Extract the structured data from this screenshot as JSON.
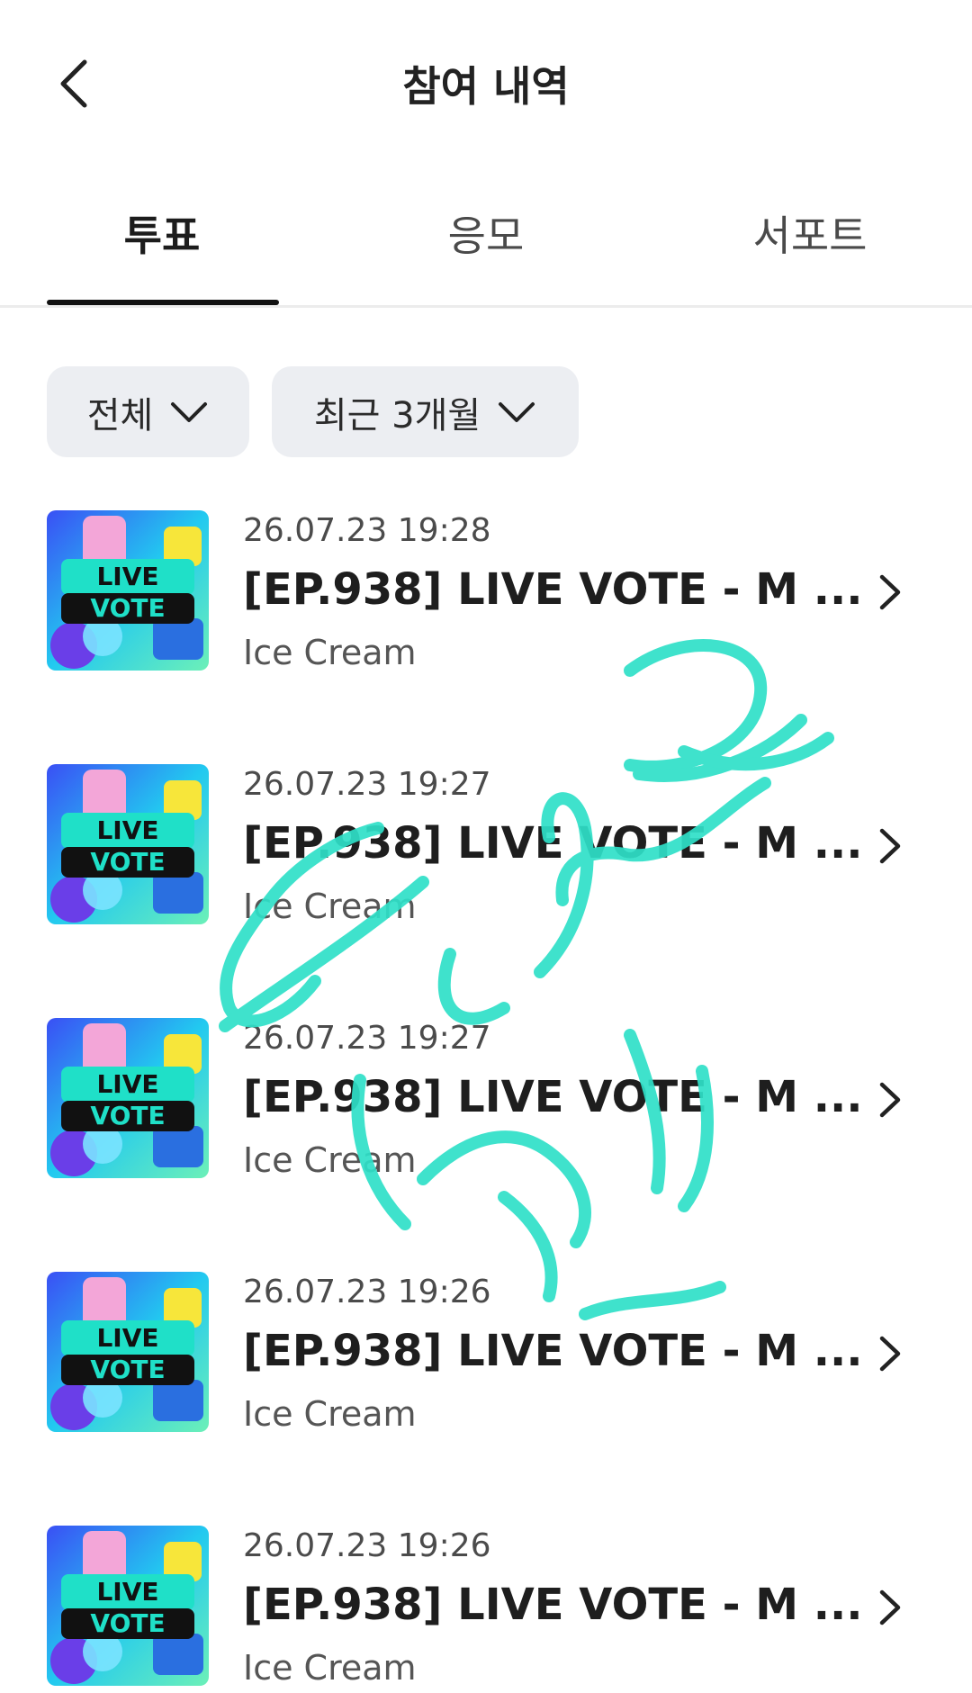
{
  "header": {
    "title": "참여 내역",
    "back_icon": "chevron-left-icon"
  },
  "tabs": [
    {
      "label": "투표",
      "active": true
    },
    {
      "label": "응모",
      "active": false
    },
    {
      "label": "서포트",
      "active": false
    }
  ],
  "filters": {
    "type": {
      "label": "전체",
      "icon": "chevron-down-icon"
    },
    "period": {
      "label": "최근 3개월",
      "icon": "chevron-down-icon"
    }
  },
  "items": [
    {
      "date": "26.07.23 19:28",
      "title": "[EP.938] LIVE VOTE - M ...",
      "subtitle": "Ice Cream",
      "thumb_line1": "LIVE",
      "thumb_line2": "VOTE"
    },
    {
      "date": "26.07.23 19:27",
      "title": "[EP.938] LIVE VOTE - M ...",
      "subtitle": "Ice Cream",
      "thumb_line1": "LIVE",
      "thumb_line2": "VOTE"
    },
    {
      "date": "26.07.23 19:27",
      "title": "[EP.938] LIVE VOTE - M ...",
      "subtitle": "Ice Cream",
      "thumb_line1": "LIVE",
      "thumb_line2": "VOTE"
    },
    {
      "date": "26.07.23 19:26",
      "title": "[EP.938] LIVE VOTE - M ...",
      "subtitle": "Ice Cream",
      "thumb_line1": "LIVE",
      "thumb_line2": "VOTE"
    },
    {
      "date": "26.07.23 19:26",
      "title": "[EP.938] LIVE VOTE - M ...",
      "subtitle": "Ice Cream",
      "thumb_line1": "LIVE",
      "thumb_line2": "VOTE"
    }
  ],
  "watermark_color": "#2fe0c8",
  "accent_color": "#111111"
}
